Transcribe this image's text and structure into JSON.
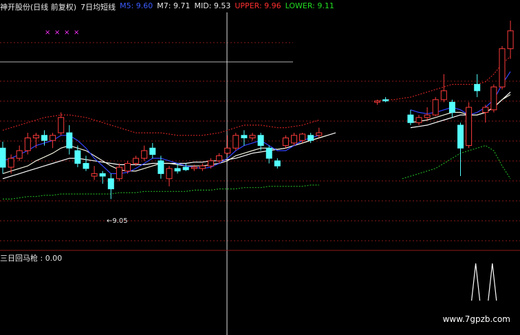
{
  "main_legend": {
    "name": "神开股份(日线 前复权)",
    "indicator": "7日均短线",
    "m5": "M5: 9.60",
    "m7": "M7: 9.71",
    "mid": "MID: 9.53",
    "upper": "UPPER: 9.96",
    "lower": "LOWER: 9.11"
  },
  "low_annotation": "←9.05",
  "sub_legend": "三日回马枪 : 0.00",
  "watermark": "www.7gpzb.com",
  "colors": {
    "up": "#ff3b3b",
    "down": "#54ffff",
    "m5": "#3344ff",
    "m7": "#f2f2e0",
    "mid": "#ffffff",
    "upper": "#cc2222",
    "lower": "#22aa22",
    "grid": "#8b1a1a",
    "signal_marks": "#ff33ff",
    "sub_signal": "#ffffff"
  },
  "signal_markers": [
    "×",
    "×",
    "×",
    "×"
  ],
  "chart_data": {
    "type": "candlestick",
    "ylim": [
      8.9,
      10.6
    ],
    "candles": [
      {
        "o": 9.6,
        "h": 9.65,
        "l": 9.4,
        "c": 9.45
      },
      {
        "o": 9.45,
        "h": 9.55,
        "l": 9.4,
        "c": 9.52
      },
      {
        "o": 9.52,
        "h": 9.62,
        "l": 9.5,
        "c": 9.58
      },
      {
        "o": 9.58,
        "h": 9.72,
        "l": 9.55,
        "c": 9.68
      },
      {
        "o": 9.68,
        "h": 9.72,
        "l": 9.6,
        "c": 9.7
      },
      {
        "o": 9.7,
        "h": 9.74,
        "l": 9.62,
        "c": 9.66
      },
      {
        "o": 9.66,
        "h": 9.72,
        "l": 9.6,
        "c": 9.7
      },
      {
        "o": 9.72,
        "h": 9.88,
        "l": 9.7,
        "c": 9.84
      },
      {
        "o": 9.72,
        "h": 9.78,
        "l": 9.55,
        "c": 9.6
      },
      {
        "o": 9.58,
        "h": 9.62,
        "l": 9.45,
        "c": 9.48
      },
      {
        "o": 9.48,
        "h": 9.54,
        "l": 9.42,
        "c": 9.44
      },
      {
        "o": 9.38,
        "h": 9.46,
        "l": 9.35,
        "c": 9.4
      },
      {
        "o": 9.4,
        "h": 9.42,
        "l": 9.32,
        "c": 9.38
      },
      {
        "o": 9.36,
        "h": 9.4,
        "l": 9.2,
        "c": 9.28
      },
      {
        "o": 9.36,
        "h": 9.48,
        "l": 9.34,
        "c": 9.45
      },
      {
        "o": 9.42,
        "h": 9.5,
        "l": 9.4,
        "c": 9.48
      },
      {
        "o": 9.48,
        "h": 9.54,
        "l": 9.46,
        "c": 9.52
      },
      {
        "o": 9.52,
        "h": 9.62,
        "l": 9.5,
        "c": 9.58
      },
      {
        "o": 9.6,
        "h": 9.64,
        "l": 9.52,
        "c": 9.55
      },
      {
        "o": 9.5,
        "h": 9.54,
        "l": 9.36,
        "c": 9.4
      },
      {
        "o": 9.36,
        "h": 9.46,
        "l": 9.3,
        "c": 9.44
      },
      {
        "o": 9.44,
        "h": 9.48,
        "l": 9.4,
        "c": 9.42
      },
      {
        "o": 9.45,
        "h": 9.48,
        "l": 9.42,
        "c": 9.43
      },
      {
        "o": 9.44,
        "h": 9.47,
        "l": 9.42,
        "c": 9.45
      },
      {
        "o": 9.44,
        "h": 9.48,
        "l": 9.42,
        "c": 9.46
      },
      {
        "o": 9.46,
        "h": 9.52,
        "l": 9.44,
        "c": 9.5
      },
      {
        "o": 9.5,
        "h": 9.56,
        "l": 9.48,
        "c": 9.54
      },
      {
        "o": 9.56,
        "h": 9.7,
        "l": 9.55,
        "c": 9.6
      },
      {
        "o": 9.6,
        "h": 9.72,
        "l": 9.58,
        "c": 9.7
      },
      {
        "o": 9.7,
        "h": 9.74,
        "l": 9.62,
        "c": 9.68
      },
      {
        "o": 9.68,
        "h": 9.72,
        "l": 9.66,
        "c": 9.7
      },
      {
        "o": 9.7,
        "h": 9.72,
        "l": 9.58,
        "c": 9.62
      },
      {
        "o": 9.6,
        "h": 9.62,
        "l": 9.48,
        "c": 9.52
      },
      {
        "o": 9.5,
        "h": 9.52,
        "l": 9.44,
        "c": 9.46
      },
      {
        "o": 9.62,
        "h": 9.7,
        "l": 9.6,
        "c": 9.68
      },
      {
        "o": 9.64,
        "h": 9.72,
        "l": 9.62,
        "c": 9.7
      },
      {
        "o": 9.66,
        "h": 9.72,
        "l": 9.64,
        "c": 9.71
      },
      {
        "o": 9.7,
        "h": 9.72,
        "l": 9.64,
        "c": 9.66
      },
      {
        "o": 9.7,
        "h": 9.76,
        "l": 9.68,
        "c": 9.72
      },
      null,
      null,
      null,
      null,
      null,
      null,
      {
        "o": 9.96,
        "h": 9.98,
        "l": 9.94,
        "c": 9.97
      },
      {
        "o": 9.98,
        "h": 10.0,
        "l": 9.96,
        "c": 9.97
      },
      null,
      null,
      {
        "o": 9.86,
        "h": 9.9,
        "l": 9.78,
        "c": 9.8
      },
      {
        "o": 9.8,
        "h": 9.86,
        "l": 9.78,
        "c": 9.84
      },
      {
        "o": 9.84,
        "h": 9.92,
        "l": 9.82,
        "c": 9.86
      },
      {
        "o": 9.86,
        "h": 10.0,
        "l": 9.85,
        "c": 9.98
      },
      {
        "o": 9.98,
        "h": 10.18,
        "l": 9.96,
        "c": 10.05
      },
      {
        "o": 9.96,
        "h": 9.98,
        "l": 9.84,
        "c": 9.88
      },
      {
        "o": 9.78,
        "h": 9.8,
        "l": 9.38,
        "c": 9.6
      },
      {
        "o": 9.62,
        "h": 9.96,
        "l": 9.6,
        "c": 9.92
      },
      {
        "o": 10.1,
        "h": 10.18,
        "l": 10.0,
        "c": 10.05
      },
      {
        "o": 9.88,
        "h": 9.94,
        "l": 9.8,
        "c": 9.92
      },
      {
        "o": 9.9,
        "h": 10.1,
        "l": 9.88,
        "c": 10.08
      },
      {
        "o": 10.08,
        "h": 10.4,
        "l": 10.06,
        "c": 10.38
      },
      {
        "o": 10.38,
        "h": 10.6,
        "l": 10.3,
        "c": 10.52
      }
    ],
    "m5": [
      9.5,
      9.52,
      9.55,
      9.58,
      9.62,
      9.64,
      9.66,
      9.7,
      9.7,
      9.66,
      9.6,
      9.52,
      9.46,
      9.4,
      9.4,
      9.41,
      9.44,
      9.48,
      9.52,
      9.52,
      9.5,
      9.48,
      9.46,
      9.45,
      9.44,
      9.45,
      9.48,
      9.52,
      9.58,
      9.62,
      9.64,
      9.66,
      9.62,
      9.58,
      9.58,
      9.62,
      9.66,
      9.68,
      9.7,
      null,
      null,
      null,
      null,
      null,
      null,
      null,
      null,
      null,
      null,
      9.9,
      9.88,
      9.87,
      9.88,
      9.9,
      9.92,
      9.9,
      9.86,
      9.88,
      9.92,
      9.98,
      10.1,
      10.2
    ],
    "m7": [
      9.4,
      9.42,
      9.44,
      9.46,
      9.5,
      9.53,
      9.56,
      9.6,
      9.62,
      9.6,
      9.58,
      9.54,
      9.5,
      9.46,
      9.43,
      9.42,
      9.42,
      9.44,
      9.46,
      9.48,
      9.48,
      9.47,
      9.46,
      9.46,
      9.46,
      9.47,
      9.48,
      9.5,
      9.54,
      9.56,
      9.58,
      9.6,
      9.6,
      9.59,
      9.6,
      9.62,
      9.64,
      9.66,
      9.68,
      9.7,
      null,
      null,
      null,
      null,
      null,
      null,
      null,
      null,
      null,
      9.8,
      9.81,
      9.82,
      9.84,
      9.86,
      9.88,
      9.88,
      9.86,
      9.86,
      9.88,
      9.92,
      9.98,
      10.02
    ],
    "upper": [
      9.74,
      9.76,
      9.78,
      9.8,
      9.82,
      9.84,
      9.85,
      9.86,
      9.86,
      9.85,
      9.84,
      9.82,
      9.8,
      9.78,
      9.76,
      9.74,
      9.72,
      9.72,
      9.72,
      9.72,
      9.71,
      9.7,
      9.7,
      9.7,
      9.7,
      9.71,
      9.72,
      9.74,
      9.76,
      9.78,
      9.78,
      9.78,
      9.77,
      9.76,
      9.76,
      9.77,
      9.78,
      9.8,
      9.82,
      null,
      null,
      null,
      null,
      null,
      null,
      9.97,
      9.98,
      9.98,
      9.99,
      10.0,
      10.02,
      10.04,
      10.06,
      10.08,
      10.1,
      10.1,
      10.1,
      10.1,
      10.12,
      10.18,
      10.26,
      10.32
    ],
    "lower": [
      9.2,
      9.2,
      9.21,
      9.22,
      9.22,
      9.23,
      9.23,
      9.24,
      9.24,
      9.24,
      9.24,
      9.24,
      9.24,
      9.24,
      9.25,
      9.25,
      9.25,
      9.26,
      9.26,
      9.26,
      9.26,
      9.26,
      9.26,
      9.27,
      9.27,
      9.27,
      9.28,
      9.28,
      9.28,
      9.29,
      9.29,
      9.29,
      9.3,
      9.3,
      9.3,
      9.3,
      9.3,
      9.31,
      9.31,
      null,
      null,
      null,
      null,
      null,
      null,
      null,
      null,
      null,
      9.36,
      9.38,
      9.4,
      9.42,
      9.44,
      9.48,
      9.52,
      9.56,
      9.58,
      9.6,
      9.62,
      9.58,
      9.46,
      9.36
    ],
    "mid": [
      9.36,
      9.38,
      9.4,
      9.42,
      9.44,
      9.46,
      9.48,
      9.5,
      9.52,
      9.52,
      9.51,
      9.5,
      9.49,
      9.48,
      9.47,
      9.47,
      9.47,
      9.47,
      9.48,
      9.48,
      9.48,
      9.48,
      9.48,
      9.49,
      9.49,
      9.5,
      9.5,
      9.51,
      9.52,
      9.54,
      9.56,
      9.57,
      9.58,
      9.59,
      9.6,
      9.62,
      9.64,
      9.66,
      9.68,
      9.7,
      9.72,
      null,
      null,
      null,
      null,
      null,
      null,
      null,
      null,
      9.76,
      9.77,
      9.78,
      9.8,
      9.82,
      9.84,
      9.86,
      9.86,
      9.86,
      9.88,
      9.92,
      9.98,
      10.04
    ],
    "sub_signal": [
      0,
      0,
      0,
      0,
      0,
      0,
      0,
      0,
      0,
      0,
      0,
      0,
      0,
      0,
      0,
      0,
      0,
      0,
      0,
      0,
      0,
      0,
      0,
      0,
      0,
      0,
      0,
      0,
      0,
      0,
      0,
      0,
      0,
      0,
      0,
      0,
      0,
      0,
      0,
      0,
      0,
      0,
      0,
      0,
      0,
      0,
      0,
      0,
      0,
      0,
      0,
      0,
      0,
      0,
      0,
      0,
      1,
      0,
      1,
      0,
      0,
      0
    ],
    "sub_ylim": [
      0,
      1
    ]
  }
}
